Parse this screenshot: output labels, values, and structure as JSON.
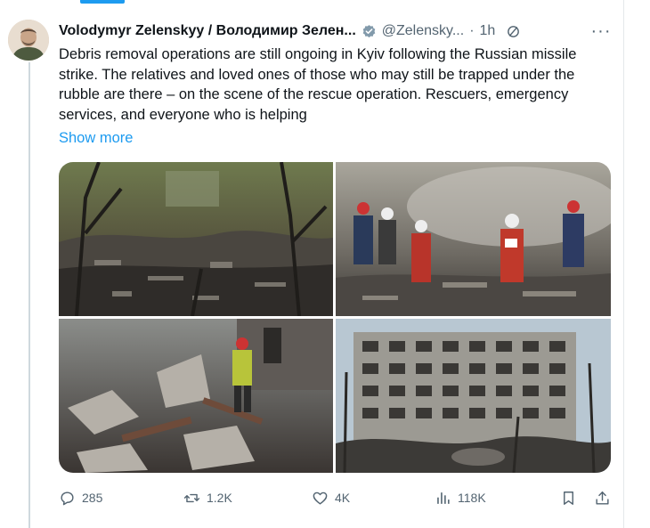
{
  "tweet": {
    "author_name": "Volodymyr Zelenskyy / Володимир Зелен...",
    "handle": "@Zelensky...",
    "separator": "·",
    "time": "1h",
    "text": "Debris removal operations are still ongoing in Kyiv following the Russian missile strike. The relatives and loved ones of those who may still be trapped under the rubble are there – on the scene of the rescue operation. Rescuers, emergency services, and everyone who is helping",
    "show_more_label": "Show more"
  },
  "media": {
    "photos": [
      {
        "icon": "photo-debris-trees"
      },
      {
        "icon": "photo-rescuers-smoke"
      },
      {
        "icon": "photo-rescuer-rubble"
      },
      {
        "icon": "photo-damaged-building"
      }
    ]
  },
  "actions": {
    "replies": "285",
    "reposts": "1.2K",
    "likes": "4K",
    "views": "118K"
  },
  "colors": {
    "accent": "#1d9bf0",
    "secondary_text": "#536471",
    "primary_text": "#0f1419"
  }
}
